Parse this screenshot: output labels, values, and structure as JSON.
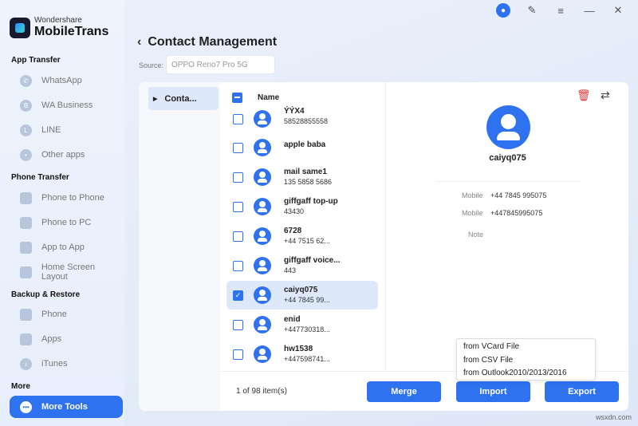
{
  "app": {
    "brand": "Wondershare",
    "product": "MobileTrans"
  },
  "sidebar": {
    "sections": [
      {
        "title": "App Transfer"
      },
      {
        "title": "Phone Transfer"
      },
      {
        "title": "Backup & Restore"
      },
      {
        "title": "More"
      }
    ],
    "items": [
      {
        "label": "WhatsApp",
        "icon": "whatsapp-icon"
      },
      {
        "label": "WA Business",
        "icon": "wa-business-icon"
      },
      {
        "label": "LINE",
        "icon": "line-icon"
      },
      {
        "label": "Other apps",
        "icon": "other-apps-icon"
      },
      {
        "label": "Phone to Phone",
        "icon": "phone-to-phone-icon"
      },
      {
        "label": "Phone to PC",
        "icon": "phone-to-pc-icon"
      },
      {
        "label": "App to App",
        "icon": "app-to-app-icon"
      },
      {
        "label": "Home Screen Layout",
        "icon": "home-screen-layout-icon"
      },
      {
        "label": "Phone",
        "icon": "phone-icon"
      },
      {
        "label": "Apps",
        "icon": "apps-icon"
      },
      {
        "label": "iTunes",
        "icon": "itunes-icon"
      },
      {
        "label": "More Tools",
        "icon": "more-tools-icon",
        "active": true
      }
    ]
  },
  "topbar": {
    "icons": [
      "user-icon",
      "edit-icon",
      "menu-icon",
      "minimize-icon",
      "close-icon"
    ]
  },
  "header": {
    "title": "Contact Management",
    "source_label": "Source:",
    "source_value": "OPPO Reno7 Pro 5G"
  },
  "groups": [
    {
      "label": "Conta..."
    }
  ],
  "contacts_header": {
    "name_col": "Name"
  },
  "contacts": [
    {
      "name": "ÝÝX4",
      "phone": "58528855558",
      "checked": false
    },
    {
      "name": "apple baba",
      "phone": "",
      "checked": false
    },
    {
      "name": "mail same1",
      "phone": "135 5858 5686",
      "checked": false
    },
    {
      "name": "giffgaff top-up",
      "phone": "43430",
      "checked": false
    },
    {
      "name": "6728",
      "phone": "+44 7515 62...",
      "checked": false
    },
    {
      "name": "giffgaff voice...",
      "phone": "443",
      "checked": false
    },
    {
      "name": "caiyq075",
      "phone": "+44 7845 99...",
      "checked": true,
      "selected": true
    },
    {
      "name": "enid",
      "phone": "+447730318...",
      "checked": false
    },
    {
      "name": "hw1538",
      "phone": "+447598741...",
      "checked": false
    }
  ],
  "footer": {
    "count": "1 of 98 item(s)"
  },
  "detail": {
    "name": "caiyq075",
    "fields": [
      {
        "label": "Mobile",
        "value": "+44 7845 995075"
      },
      {
        "label": "Mobile",
        "value": "+447845995075"
      },
      {
        "label": "Note",
        "value": ""
      }
    ]
  },
  "buttons": {
    "merge": "Merge",
    "import": "Import",
    "export": "Export"
  },
  "import_menu": [
    "from VCard File",
    "from CSV File",
    "from Outlook2010/2013/2016"
  ],
  "watermark": "wsxdn.com",
  "colors": {
    "accent": "#2f72f0",
    "danger": "#e53935"
  }
}
